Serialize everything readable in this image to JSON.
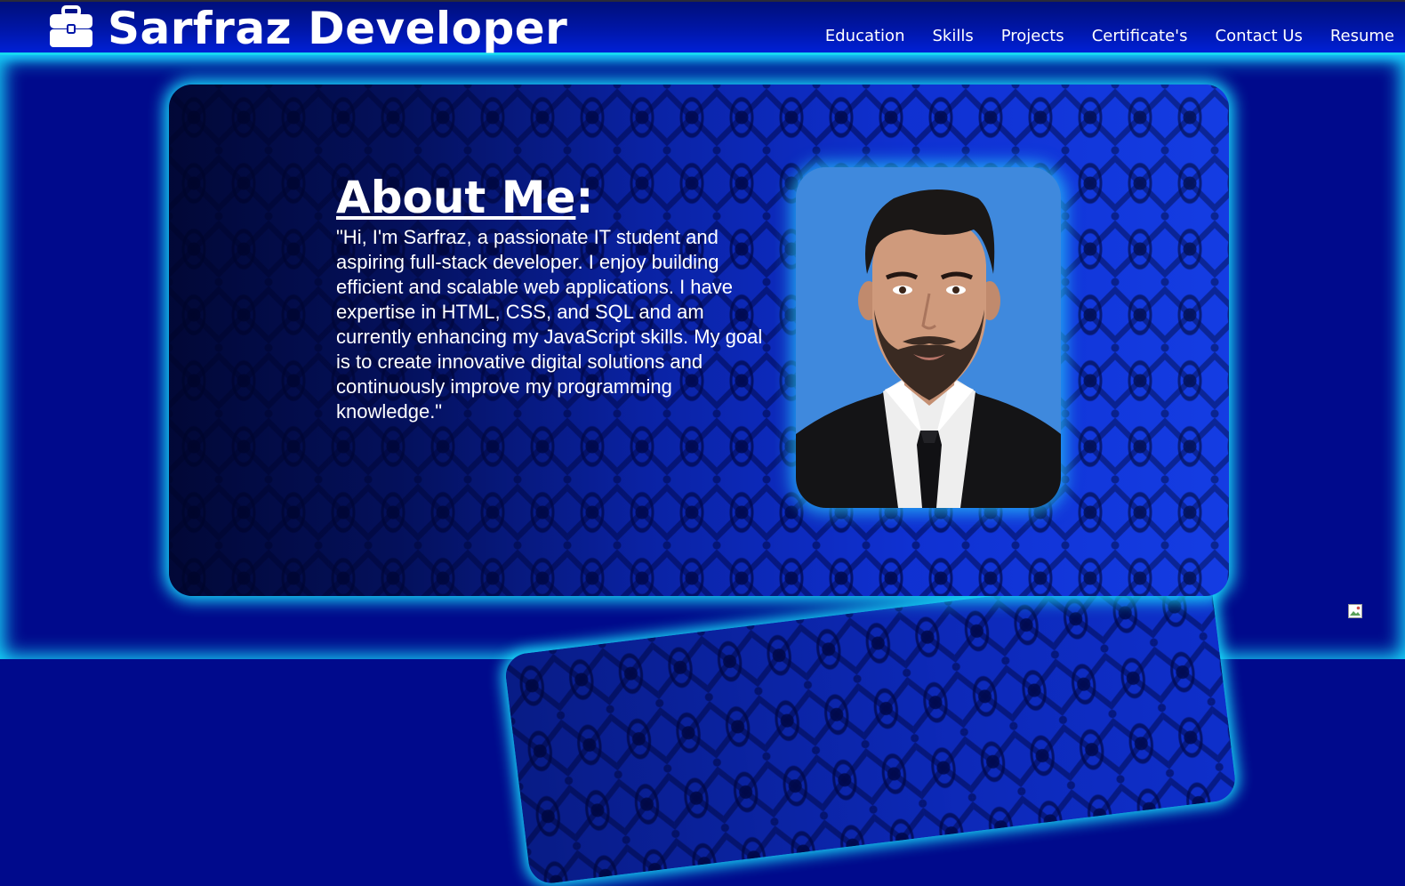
{
  "header": {
    "brand_icon": "briefcase-icon",
    "brand_name": "Sarfraz Developer",
    "nav": [
      {
        "label": "Education"
      },
      {
        "label": "Skills"
      },
      {
        "label": "Projects"
      },
      {
        "label": "Certificate's"
      },
      {
        "label": "Contact Us"
      },
      {
        "label": "Resume"
      }
    ]
  },
  "about": {
    "title": "About Me",
    "title_colon": ":",
    "body": "\"Hi, I'm Sarfraz, a passionate IT student and aspiring full-stack developer. I enjoy building efficient and scalable web applications. I have expertise in HTML, CSS, and SQL and am currently enhancing my JavaScript skills. My goal is to create innovative digital solutions and continuously improve my programming knowledge.\"",
    "portrait_icon": "profile-photo"
  },
  "broken_image_icon": "broken-image-icon",
  "colors": {
    "page_background": "#000a8c",
    "glow": "#18e4ff",
    "pattern_blue": "#1236e0",
    "portrait_background": "#3c87dc",
    "text": "#ffffff"
  }
}
